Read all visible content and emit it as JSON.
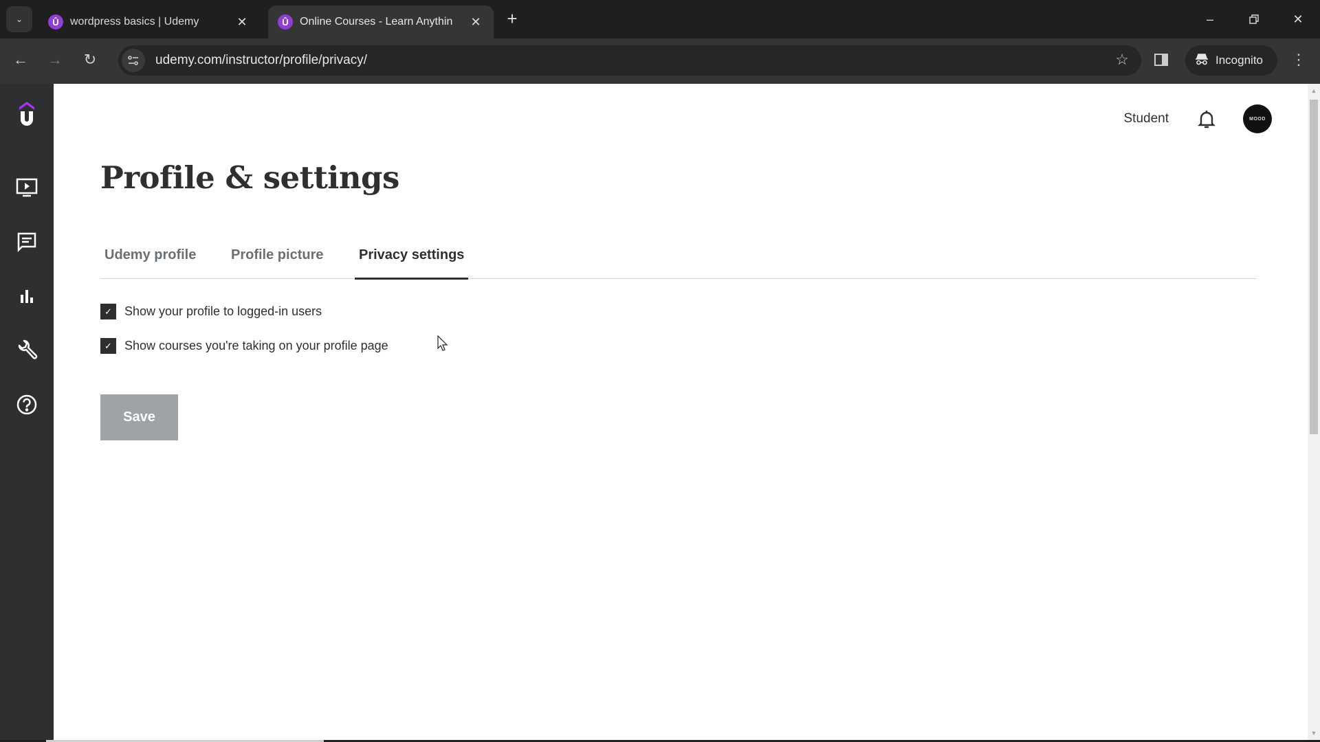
{
  "browser": {
    "tabs": [
      {
        "title": "wordpress basics | Udemy",
        "active": false,
        "favicon": "udemy-favicon"
      },
      {
        "title": "Online Courses - Learn Anythin",
        "active": true,
        "favicon": "udemy-favicon"
      }
    ],
    "new_tab_label": "+",
    "url": "udemy.com/instructor/profile/privacy/",
    "incognito_label": "Incognito"
  },
  "sidebar": {
    "items": [
      {
        "name": "courses",
        "icon": "video-screen-icon"
      },
      {
        "name": "communication",
        "icon": "chat-icon"
      },
      {
        "name": "performance",
        "icon": "bar-chart-icon"
      },
      {
        "name": "tools",
        "icon": "wrench-icon"
      },
      {
        "name": "resources",
        "icon": "help-icon"
      }
    ]
  },
  "header": {
    "student_label": "Student",
    "avatar_text": "MOOD"
  },
  "page": {
    "title": "Profile & settings",
    "tabs": [
      {
        "label": "Udemy profile",
        "active": false
      },
      {
        "label": "Profile picture",
        "active": false
      },
      {
        "label": "Privacy settings",
        "active": true
      }
    ],
    "options": [
      {
        "label": "Show your profile to logged-in users",
        "checked": true
      },
      {
        "label": "Show courses you're taking on your profile page",
        "checked": true
      }
    ],
    "save_label": "Save"
  },
  "colors": {
    "brand_purple": "#a435f0",
    "sidebar_bg": "#2d2f31",
    "text_primary": "#2d2f31",
    "text_muted": "#6a6f73",
    "save_disabled": "#9da3a7"
  }
}
